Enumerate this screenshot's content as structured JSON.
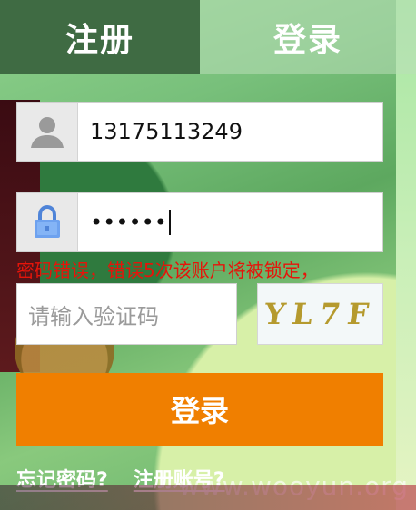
{
  "tabs": {
    "register": "注册",
    "login": "登录"
  },
  "fields": {
    "phone": {
      "value": "13175113249",
      "icon": "user-icon"
    },
    "password": {
      "value": "••••••",
      "icon": "lock-icon"
    }
  },
  "error_message": "密码错误，错误5次该账户将被锁定，",
  "captcha": {
    "placeholder": "请输入验证码",
    "image_text": "YL7F"
  },
  "login_button": "登录",
  "links": {
    "forgot_password": "忘记密码?",
    "register_account": "注册账号?"
  },
  "watermark": "www.wooyun.org",
  "colors": {
    "button": "#f07f00",
    "error": "#e6140a",
    "tab_active": "#3f6b43"
  }
}
